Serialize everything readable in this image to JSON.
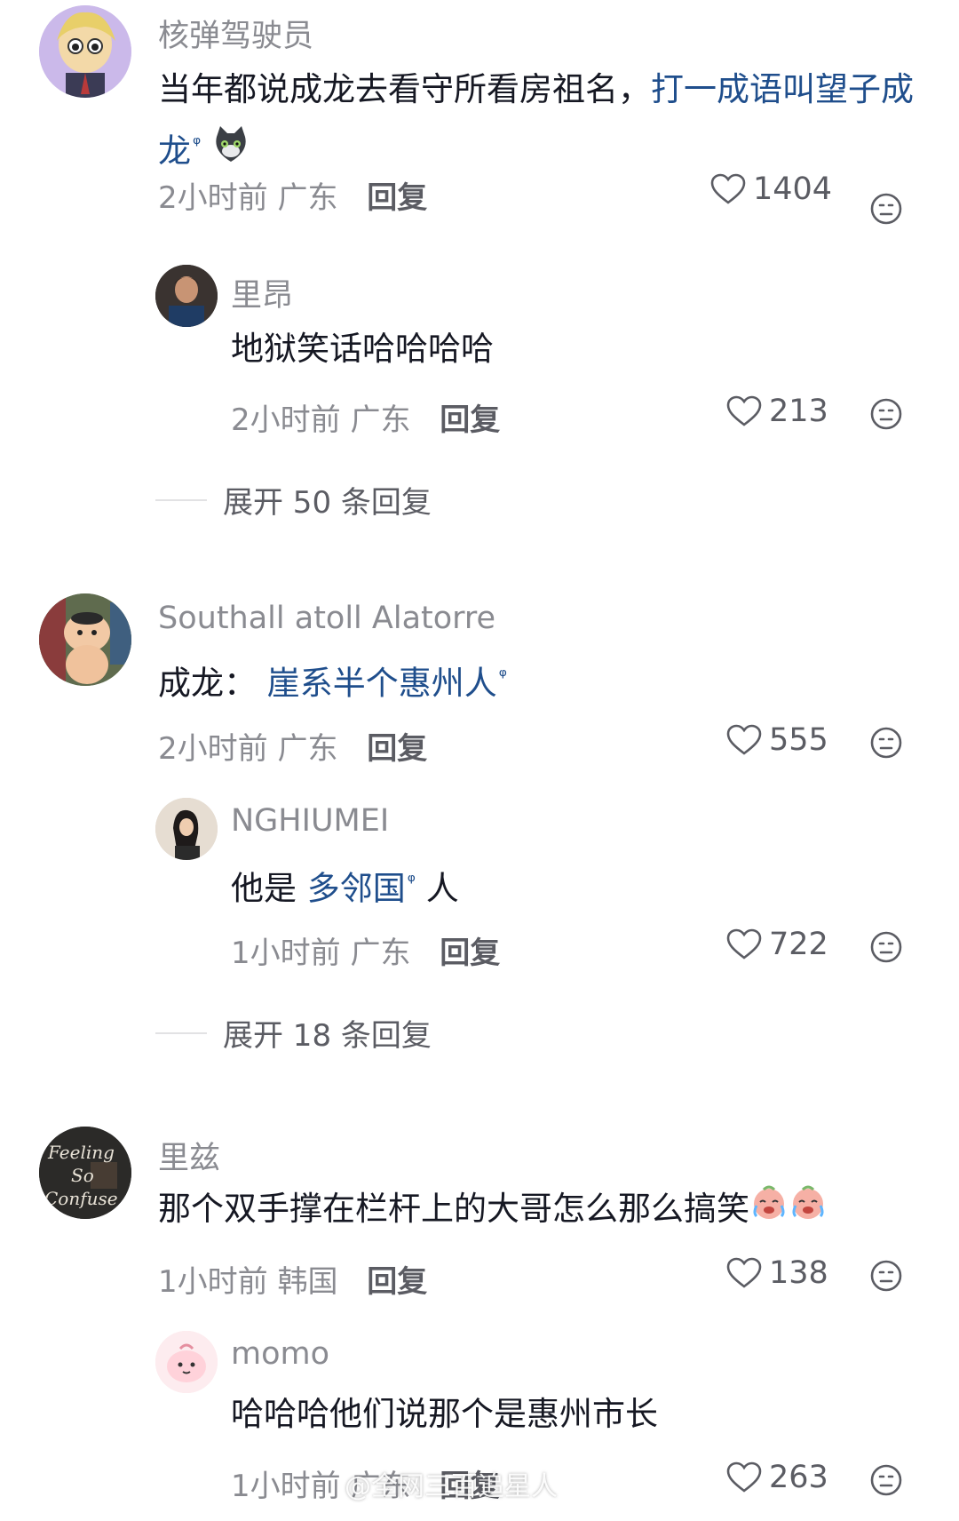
{
  "comments": [
    {
      "user": "核弹驾驶员",
      "text_plain": "当年都说成龙去看守所看房祖名，",
      "text_link": "打一成语叫望子成龙",
      "time": "2小时前",
      "location": "广东",
      "reply_label": "回复",
      "likes": "1404",
      "replies": [
        {
          "user": "里昂",
          "text": "地狱笑话哈哈哈哈",
          "time": "2小时前",
          "location": "广东",
          "reply_label": "回复",
          "likes": "213"
        }
      ],
      "expand": "展开 50 条回复"
    },
    {
      "user": "Southall atoll Alatorre",
      "text_plain": "成龙：",
      "text_link": "崖系半个惠州人",
      "time": "2小时前",
      "location": "广东",
      "reply_label": "回复",
      "likes": "555",
      "replies": [
        {
          "user": "NGHIUMEI",
          "text_plain": "他是",
          "text_link": "多邻国",
          "text_after": "人",
          "time": "1小时前",
          "location": "广东",
          "reply_label": "回复",
          "likes": "722"
        }
      ],
      "expand": "展开 18 条回复"
    },
    {
      "user": "里兹",
      "text": "那个双手撑在栏杆上的大哥怎么那么搞笑",
      "time": "1小时前",
      "location": "韩国",
      "reply_label": "回复",
      "likes": "138",
      "replies": [
        {
          "user": "momo",
          "text": "哈哈哈他们说那个是惠州市长",
          "time": "1小时前",
          "location": "广东",
          "reply_label": "回复",
          "likes": "263"
        }
      ]
    }
  ],
  "watermark": "@全网三百追星人",
  "colors": {
    "link": "#1f4e8c",
    "meta": "#8a8b91",
    "text": "#161823"
  },
  "icons": [
    "heart-icon",
    "dislike-face-icon",
    "search-link-icon",
    "cat-emoji",
    "crying-laugh-emoji"
  ]
}
